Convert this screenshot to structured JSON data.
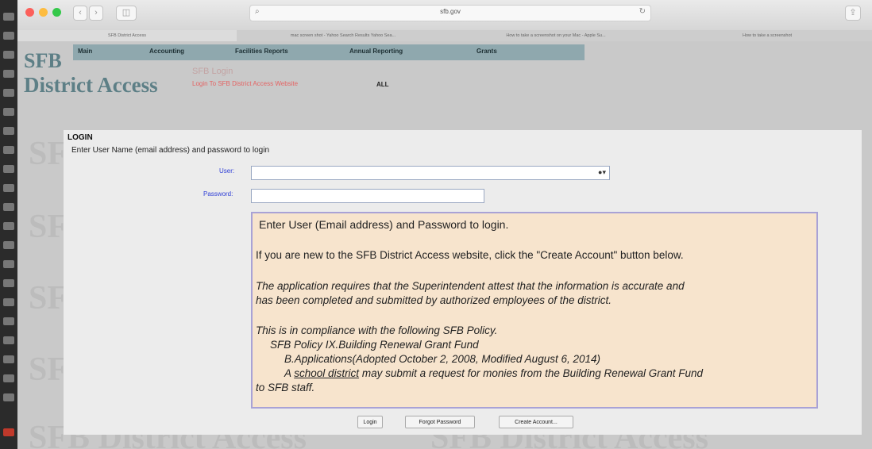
{
  "browser": {
    "url": "sfb.gov",
    "tabs": [
      "SFB District Access",
      "mac screen shot - Yahoo Search Results Yahoo Sea...",
      "How to take a screenshot on your Mac - Apple Su...",
      "How to take a screenshot"
    ],
    "nav_back": "‹",
    "nav_forward": "›",
    "sidebar_icon": "◫",
    "search_icon": "⌕",
    "reload_icon": "↻",
    "share_icon": "⇪"
  },
  "site": {
    "logo_line1": "SFB",
    "logo_line2": "District Access",
    "watermark": "SFB District Access",
    "menu": [
      "Main",
      "Accounting",
      "Facilities Reports",
      "Annual Reporting",
      "Grants"
    ],
    "subheader": {
      "title": "SFB Login",
      "link": "Login To SFB District Access Website",
      "scope": "ALL"
    }
  },
  "login": {
    "heading": "LOGIN",
    "instruction": "Enter User Name (email address) and password to login",
    "user_label": "User:",
    "user_value": "",
    "password_label": "Password:",
    "password_value": "",
    "info": {
      "p1": "Enter User (Email address) and Password to login.",
      "p2": "If you are new to the SFB District Access website, click the \"Create Account\" button below.",
      "p3a": "The application requires that the Superintendent attest that the information is accurate and",
      "p3b": "has been completed and submitted by authorized employees of the district.",
      "p4": "This is in compliance with the following SFB Policy.",
      "p5": "SFB Policy IX.Building Renewal Grant Fund",
      "p6": "B.Applications(Adopted October 2, 2008, Modified August 6, 2014)",
      "p7a": "A",
      "p7link": "school district",
      "p7b": "may submit a request for monies from the Building Renewal Grant Fund",
      "p7c": "to SFB staff."
    },
    "buttons": {
      "login": "Login",
      "forgot": "Forgot Password",
      "create": "Create Account..."
    }
  },
  "colors": {
    "logo": "#5d7f86",
    "menubar": "#8fa8ae",
    "info_bg": "#f7e4cd",
    "info_border": "#a9a2d6",
    "field_label": "#2f3fd6",
    "link_red": "#e46464"
  }
}
